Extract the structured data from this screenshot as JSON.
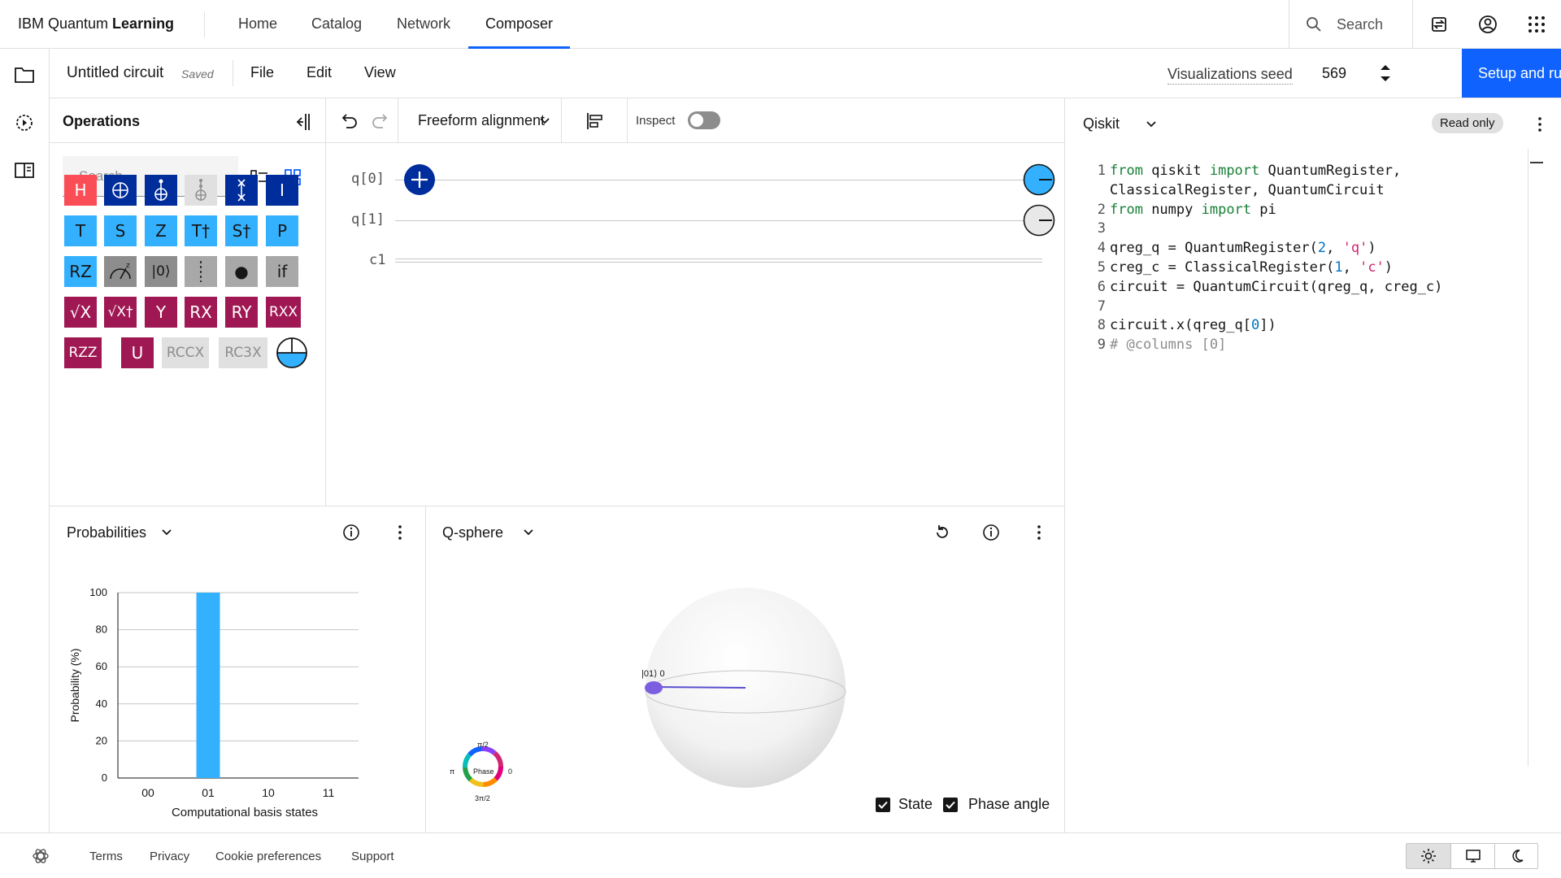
{
  "header": {
    "brand_prefix": "IBM Quantum ",
    "brand_bold": "Learning",
    "nav": [
      {
        "label": "Home",
        "active": false
      },
      {
        "label": "Catalog",
        "active": false
      },
      {
        "label": "Network",
        "active": false
      },
      {
        "label": "Composer",
        "active": true
      }
    ],
    "search_placeholder": "Search",
    "icons": [
      "search-icon",
      "switch-account-icon",
      "user-avatar-icon",
      "app-switcher-icon"
    ]
  },
  "rail": {
    "icons": [
      "folder-icon",
      "job-history-icon",
      "panel-layout-icon"
    ]
  },
  "circuitbar": {
    "circuit_name": "Untitled circuit",
    "saved_label": "Saved",
    "menus": [
      "File",
      "Edit",
      "View"
    ],
    "seed_label": "Visualizations seed",
    "seed_value": "569",
    "run_label": "Setup and run"
  },
  "operations": {
    "title": "Operations",
    "search_placeholder": "Search",
    "gates": [
      {
        "label": "H",
        "style": "g-red"
      },
      {
        "label": "",
        "icon": "cnot-gate-icon",
        "style": "g-navy"
      },
      {
        "label": "",
        "icon": "toffoli-gate-icon",
        "style": "g-navy"
      },
      {
        "label": "",
        "icon": "controlled-gate-icon",
        "style": "g-light"
      },
      {
        "label": "",
        "icon": "swap-gate-icon",
        "style": "g-navy"
      },
      {
        "label": "I",
        "style": "g-navy"
      },
      {
        "label": "T",
        "style": "g-cyan"
      },
      {
        "label": "S",
        "style": "g-cyan"
      },
      {
        "label": "Z",
        "style": "g-cyan"
      },
      {
        "label": "T†",
        "style": "g-cyan"
      },
      {
        "label": "S†",
        "style": "g-cyan"
      },
      {
        "label": "P",
        "style": "g-cyan"
      },
      {
        "label": "RZ",
        "style": "g-cyan"
      },
      {
        "label": "",
        "icon": "measure-z-icon",
        "style": "g-gray"
      },
      {
        "label": "|0⟩",
        "style": "g-gray"
      },
      {
        "label": "",
        "icon": "barrier-icon",
        "style": "g-gray2"
      },
      {
        "label": "●",
        "style": "g-gray2"
      },
      {
        "label": "if",
        "style": "g-gray2"
      },
      {
        "label": "√X",
        "style": "g-magenta"
      },
      {
        "label": "√X†",
        "style": "g-magenta"
      },
      {
        "label": "Y",
        "style": "g-magenta"
      },
      {
        "label": "RX",
        "style": "g-magenta"
      },
      {
        "label": "RY",
        "style": "g-magenta"
      },
      {
        "label": "RXX",
        "style": "g-magenta"
      },
      {
        "label": "RZZ",
        "style": "g-magenta"
      },
      {
        "label": "U",
        "style": "g-magenta"
      },
      {
        "label": "RCCX",
        "style": "g-disabled"
      },
      {
        "label": "RC3X",
        "style": "g-disabled"
      },
      {
        "label": "",
        "icon": "custom-gate-icon",
        "style": "none"
      }
    ]
  },
  "canvas": {
    "alignment": "Freeform alignment",
    "inspect_label": "Inspect",
    "wires": [
      "q[0]",
      "q[1]",
      "c1"
    ]
  },
  "code": {
    "language": "Qiskit",
    "readonly_label": "Read only",
    "lines": [
      {
        "n": "1",
        "html": "<span class='kw'>from</span> qiskit <span class='kw'>import</span> QuantumRegister,"
      },
      {
        "n": "",
        "html": "ClassicalRegister, QuantumCircuit"
      },
      {
        "n": "2",
        "html": "<span class='kw'>from</span> numpy <span class='kw'>import</span> pi"
      },
      {
        "n": "3",
        "html": ""
      },
      {
        "n": "4",
        "html": "qreg_q = QuantumRegister(<span class='num'>2</span>, <span class='str'>'q'</span>)"
      },
      {
        "n": "5",
        "html": "creg_c = ClassicalRegister(<span class='num'>1</span>, <span class='str'>'c'</span>)"
      },
      {
        "n": "6",
        "html": "circuit = QuantumCircuit(qreg_q, creg_c)"
      },
      {
        "n": "7",
        "html": ""
      },
      {
        "n": "8",
        "html": "circuit.x(qreg_q[<span class='num'>0</span>])"
      },
      {
        "n": "9",
        "html": "<span class='cmt'># @columns [0]</span>"
      }
    ]
  },
  "probabilities": {
    "title": "Probabilities"
  },
  "chart_data": {
    "type": "bar",
    "categories": [
      "00",
      "01",
      "10",
      "11"
    ],
    "values": [
      0,
      100,
      0,
      0
    ],
    "title": "",
    "xlabel": "Computational basis states",
    "ylabel": "Probability (%)",
    "ylim": [
      0,
      100
    ],
    "yticks": [
      0,
      20,
      40,
      60,
      80,
      100
    ],
    "bar_color": "#33b1ff"
  },
  "qsphere": {
    "title": "Q-sphere",
    "state_label": "|01⟩ 0",
    "phase_label": "Phase",
    "phase_top": "π/2",
    "phase_left": "π",
    "phase_right": "0",
    "phase_bottom": "3π/2",
    "check_state": "State",
    "check_phase": "Phase angle"
  },
  "footer": {
    "links": [
      "Terms",
      "Privacy",
      "Cookie preferences",
      "Support"
    ]
  },
  "colors": {
    "accent": "#0f62fe",
    "gate_red": "#fa4d56",
    "gate_navy": "#002d9c",
    "gate_cyan": "#33b1ff",
    "gate_magenta": "#9f1853"
  }
}
